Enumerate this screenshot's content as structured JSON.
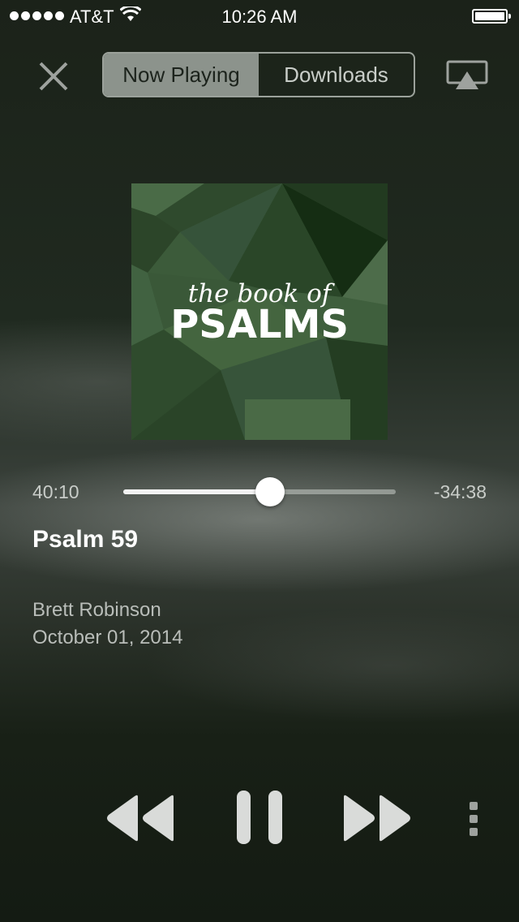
{
  "status_bar": {
    "carrier": "AT&T",
    "time": "10:26 AM",
    "signal_bars": 5
  },
  "header": {
    "tabs": [
      {
        "label": "Now Playing",
        "active": true
      },
      {
        "label": "Downloads",
        "active": false
      }
    ],
    "close_icon": "close-icon",
    "airplay_icon": "airplay-icon"
  },
  "artwork": {
    "subtitle": "the book of",
    "title": "PSALMS"
  },
  "player": {
    "elapsed": "40:10",
    "remaining": "-34:38",
    "progress": 0.54,
    "title": "Psalm 59",
    "author": "Brett Robinson",
    "date": "October 01, 2014"
  },
  "controls": [
    "rewind-icon",
    "pause-icon",
    "fast-forward-icon",
    "more-icon"
  ],
  "colors": {
    "accent": "#8c938c",
    "art_green": "#3a5a38",
    "background": "#1b2219"
  }
}
